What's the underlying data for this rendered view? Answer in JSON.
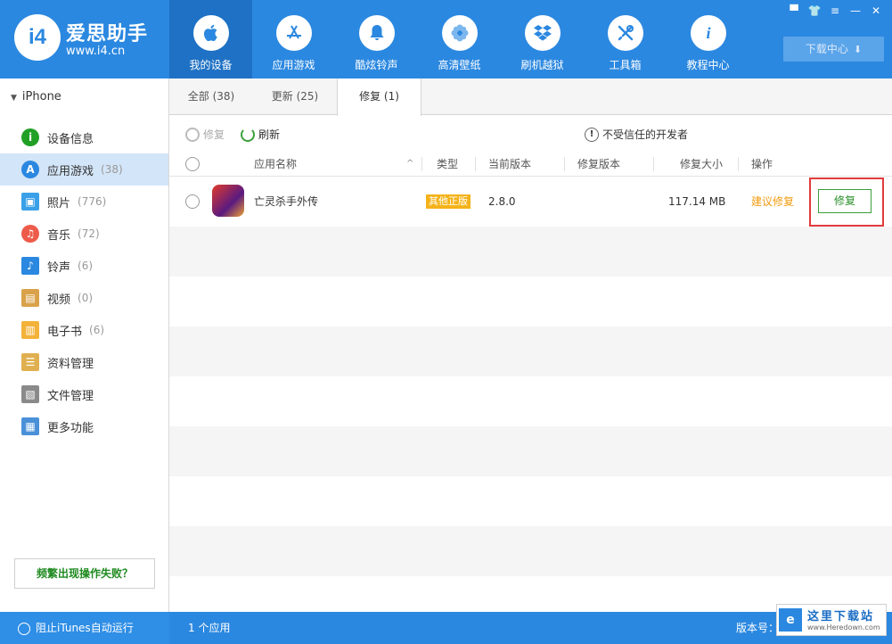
{
  "app": {
    "name": "爱思助手",
    "url": "www.i4.cn",
    "logo_text": "i4"
  },
  "nav": [
    {
      "label": "我的设备",
      "icon": "apple-icon",
      "active": true
    },
    {
      "label": "应用游戏",
      "icon": "app-store-icon",
      "active": false
    },
    {
      "label": "酷炫铃声",
      "icon": "bell-icon",
      "active": false
    },
    {
      "label": "高清壁纸",
      "icon": "flower-icon",
      "active": false
    },
    {
      "label": "刷机越狱",
      "icon": "dropbox-icon",
      "active": false
    },
    {
      "label": "工具箱",
      "icon": "tools-icon",
      "active": false
    },
    {
      "label": "教程中心",
      "icon": "info-icon",
      "active": false
    }
  ],
  "download_center": {
    "label": "下载中心",
    "arrow": "⬇"
  },
  "window_controls": [
    "▀",
    "👕",
    "≡",
    "—",
    "✕"
  ],
  "sidebar": {
    "device": "iPhone",
    "items": [
      {
        "label": "设备信息",
        "count": "",
        "icon": "info-circle-icon",
        "color": "#21a026",
        "active": false
      },
      {
        "label": "应用游戏",
        "count": "(38)",
        "icon": "app-store-icon",
        "color": "#2b88e0",
        "active": true
      },
      {
        "label": "照片",
        "count": "(776)",
        "icon": "photo-icon",
        "color": "#3aa0e8",
        "active": false
      },
      {
        "label": "音乐",
        "count": "(72)",
        "icon": "music-icon",
        "color": "#ee5b4a",
        "active": false
      },
      {
        "label": "铃声",
        "count": "(6)",
        "icon": "bell-icon",
        "color": "#2b88e0",
        "active": false
      },
      {
        "label": "视频",
        "count": "(0)",
        "icon": "video-icon",
        "color": "#d9a24a",
        "active": false
      },
      {
        "label": "电子书",
        "count": "(6)",
        "icon": "book-icon",
        "color": "#f3b23a",
        "active": false
      },
      {
        "label": "资料管理",
        "count": "",
        "icon": "contacts-icon",
        "color": "#e0b050",
        "active": false
      },
      {
        "label": "文件管理",
        "count": "",
        "icon": "file-icon",
        "color": "#8a8a8a",
        "active": false
      },
      {
        "label": "更多功能",
        "count": "",
        "icon": "grid-icon",
        "color": "#4a90d9",
        "active": false
      }
    ],
    "fail_button": "频繁出现操作失败？"
  },
  "tabs": [
    {
      "label": "全部 (38)",
      "active": false
    },
    {
      "label": "更新 (25)",
      "active": false
    },
    {
      "label": "修复 (1)",
      "active": true
    }
  ],
  "toolbar": {
    "repair": "修复",
    "refresh": "刷新",
    "untrusted": "不受信任的开发者"
  },
  "search": {
    "placeholder": ""
  },
  "columns": {
    "name": "应用名称",
    "type": "类型",
    "current_version": "当前版本",
    "repair_version": "修复版本",
    "repair_size": "修复大小",
    "action": "操作",
    "sort_indicator": "^"
  },
  "apps": [
    {
      "name": "亡灵杀手外传",
      "type": "其他正版",
      "current_version": "2.8.0",
      "repair_version": "",
      "size": "117.14 MB",
      "suggestion": "建议修复",
      "action": "修复"
    }
  ],
  "status": {
    "itunes": "阻止iTunes自动运行",
    "app_count": "1 个应用",
    "version_label": "版本号："
  },
  "watermark": {
    "title": "这里下载站",
    "url": "www.Heredown.com"
  }
}
